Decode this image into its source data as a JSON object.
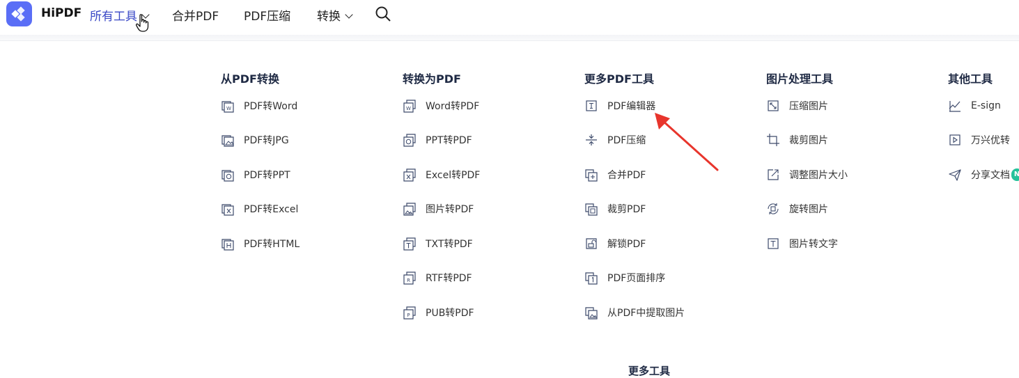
{
  "brand": "HiPDF",
  "nav": {
    "all_tools": "所有工具",
    "merge_pdf": "合并PDF",
    "compress_pdf": "PDF压缩",
    "convert": "转换"
  },
  "columns": [
    {
      "title": "从PDF转换",
      "items": [
        {
          "label": "PDF转Word",
          "icon": "word-file-icon"
        },
        {
          "label": "PDF转JPG",
          "icon": "image-file-icon"
        },
        {
          "label": "PDF转PPT",
          "icon": "ppt-file-icon"
        },
        {
          "label": "PDF转Excel",
          "icon": "excel-file-icon"
        },
        {
          "label": "PDF转HTML",
          "icon": "html-file-icon"
        }
      ]
    },
    {
      "title": "转换为PDF",
      "items": [
        {
          "label": "Word转PDF",
          "icon": "word-file-icon"
        },
        {
          "label": "PPT转PDF",
          "icon": "ppt-file-icon"
        },
        {
          "label": "Excel转PDF",
          "icon": "excel-file-icon"
        },
        {
          "label": "图片转PDF",
          "icon": "image-file-icon"
        },
        {
          "label": "TXT转PDF",
          "icon": "txt-file-icon"
        },
        {
          "label": "RTF转PDF",
          "icon": "rtf-file-icon"
        },
        {
          "label": "PUB转PDF",
          "icon": "pub-file-icon"
        }
      ]
    },
    {
      "title": "更多PDF工具",
      "items": [
        {
          "label": "PDF编辑器",
          "icon": "text-edit-icon"
        },
        {
          "label": "PDF压缩",
          "icon": "compress-icon"
        },
        {
          "label": "合并PDF",
          "icon": "merge-icon"
        },
        {
          "label": "裁剪PDF",
          "icon": "crop-pdf-icon"
        },
        {
          "label": "解锁PDF",
          "icon": "unlock-icon"
        },
        {
          "label": "PDF页面排序",
          "icon": "page-order-icon"
        },
        {
          "label": "从PDF中提取图片",
          "icon": "extract-image-icon"
        }
      ]
    },
    {
      "title": "图片处理工具",
      "items": [
        {
          "label": "压缩图片",
          "icon": "compress-image-icon"
        },
        {
          "label": "裁剪图片",
          "icon": "crop-icon"
        },
        {
          "label": "调整图片大小",
          "icon": "resize-icon"
        },
        {
          "label": "旋转图片",
          "icon": "rotate-icon"
        },
        {
          "label": "图片转文字",
          "icon": "text-icon"
        }
      ]
    },
    {
      "title": "其他工具",
      "items": [
        {
          "label": "E-sign",
          "icon": "esign-icon"
        },
        {
          "label": "万兴优转",
          "icon": "play-icon"
        },
        {
          "label": "分享文档",
          "icon": "send-icon"
        }
      ]
    }
  ],
  "more_tools": "更多工具",
  "badge": "N",
  "colors": {
    "accent": "#3a48c6",
    "logo": "#5a6ef6",
    "arrow": "#e8352c",
    "badge": "#25c29a"
  }
}
